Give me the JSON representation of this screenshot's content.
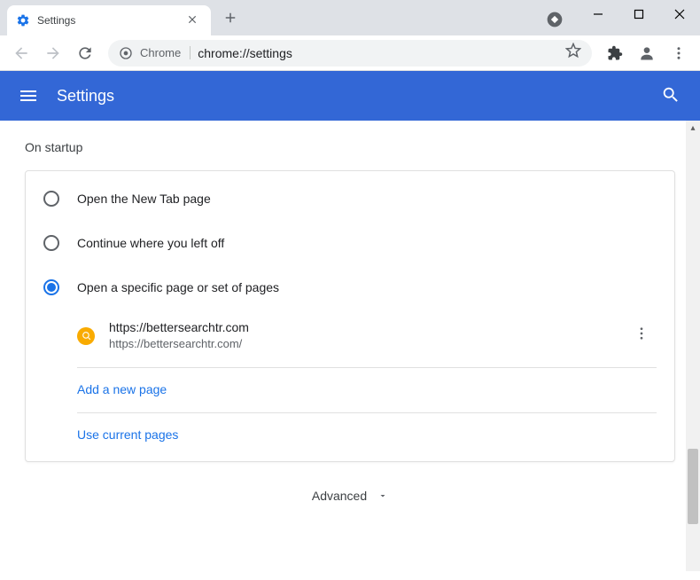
{
  "tab": {
    "title": "Settings"
  },
  "omnibox": {
    "chip": "Chrome",
    "url": "chrome://settings"
  },
  "header": {
    "title": "Settings"
  },
  "section": {
    "title": "On startup"
  },
  "options": {
    "opt1": "Open the New Tab page",
    "opt2": "Continue where you left off",
    "opt3": "Open a specific page or set of pages"
  },
  "startup_page": {
    "title": "https://bettersearchtr.com",
    "url": "https://bettersearchtr.com/"
  },
  "links": {
    "add": "Add a new page",
    "use_current": "Use current pages"
  },
  "advanced": {
    "label": "Advanced"
  }
}
